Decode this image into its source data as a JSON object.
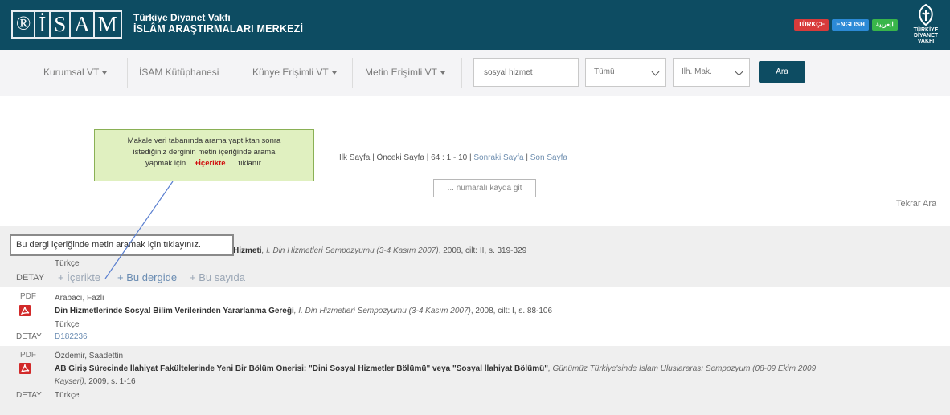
{
  "header": {
    "logo_letters": [
      "®",
      "İ",
      "S",
      "A",
      "M"
    ],
    "org_line1": "Türkiye Diyanet Vakfı",
    "org_line2": "İSLÂM ARAŞTIRMALARI MERKEZİ",
    "languages": [
      "TÜRKÇE",
      "ENGLISH",
      "العربية"
    ],
    "tdv_line1": "TÜRKİYE",
    "tdv_line2": "DİYANET VAKFI"
  },
  "nav": {
    "items": [
      "Kurumsal VT",
      "İSAM Kütüphanesi",
      "Künye Erişimli VT",
      "Metin Erişimli VT"
    ],
    "search_value": "sosyal hizmet",
    "select1": "Tümü",
    "select2": "İlh. Mak.",
    "search_button": "Ara"
  },
  "callout": {
    "line1": "Makale veri tabanında arama yaptıktan sonra",
    "line2": "istediğiniz derginin metin içeriğinde arama",
    "line3_pre": "yapmak için",
    "line3_hl": "+İçerikte",
    "line3_post": "tıklanır."
  },
  "pager": {
    "first": "İlk Sayfa",
    "prev": "Önceki Sayfa",
    "info": "64 : 1 - 10",
    "next": "Sonraki Sayfa",
    "last": "Son Sayfa",
    "sep": " | ",
    "goto_placeholder": "... numaralı kayda git",
    "tekrar": "Tekrar Ara"
  },
  "tooltip": "Bu dergi içeriğinde metin aramak için tıklayınız.",
  "results": [
    {
      "title_hl": "Hizmet",
      "title_rest": "i",
      "source_pre": ", I. Din ",
      "source_hl": "Hizmet",
      "source_post": "leri Sempozyumu (3-4 Kasım 2007)",
      "details": ", 2008, cilt: II, s. 319-329",
      "language": "Türkçe",
      "detay": "DETAY",
      "actions": [
        "+ İçerikte",
        "+ Bu dergide",
        "+ Bu sayıda"
      ]
    },
    {
      "pdf": "PDF",
      "author": "Arabacı, Fazlı",
      "title_1": "Din ",
      "title_hl1": "Hizmet",
      "title_2": "lerinde ",
      "title_hl2": "Sosyal",
      "title_3": " Bilim Verilerinden Yararlanma Gereği",
      "source_pre": ", I. Din ",
      "source_hl": "Hizmet",
      "source_post": "leri Sempozyumu (3-4 Kasım 2007)",
      "details": ", 2008, cilt: I, s. 88-106",
      "language": "Türkçe",
      "detay": "DETAY",
      "code": "D182236"
    },
    {
      "pdf": "PDF",
      "author": "Özdemir, Saadettin",
      "title_1": "AB Giriş Sürecinde İlahiyat Fakültelerinde Yeni Bir Bölüm Önerisi: \"Dini ",
      "title_hl1": "Sosyal Hizmet",
      "title_2": "ler Bölümü\" veya \"",
      "title_hl2": "Sosyal",
      "title_3": " İlahiyat Bölümü\"",
      "source": ", Günümüz Türkiye'sinde İslam Uluslararası Sempozyum (08-09 Ekim 2009",
      "source_line2": "Kayseri)",
      "details": ", 2009, s. 1-16",
      "detay": "DETAY",
      "language": "Türkçe"
    }
  ]
}
